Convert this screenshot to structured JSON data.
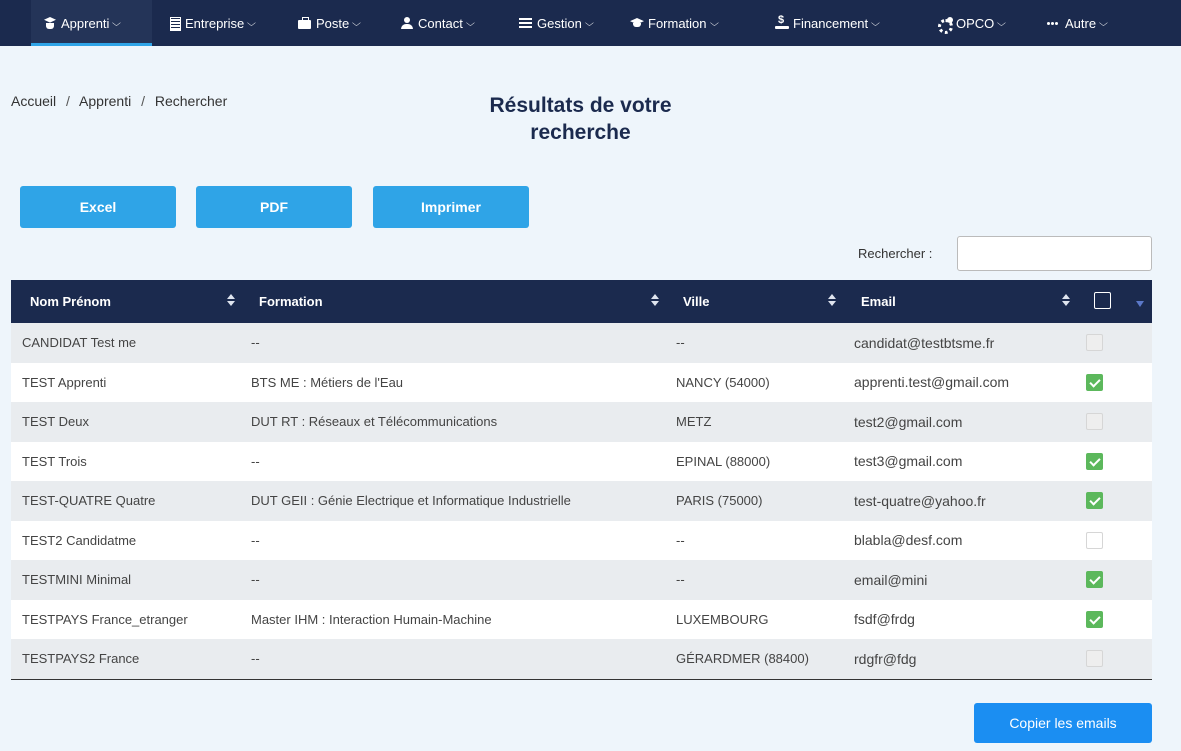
{
  "nav": [
    {
      "label": "Apprenti",
      "icon": "graduate-icon",
      "active": true
    },
    {
      "label": "Entreprise",
      "icon": "building-icon"
    },
    {
      "label": "Poste",
      "icon": "briefcase-icon"
    },
    {
      "label": "Contact",
      "icon": "user-icon"
    },
    {
      "label": "Gestion",
      "icon": "list-icon"
    },
    {
      "label": "Formation",
      "icon": "graduation-cap-icon"
    },
    {
      "label": "Financement",
      "icon": "money-hand-icon"
    },
    {
      "label": "OPCO",
      "icon": "cogs-icon"
    },
    {
      "label": "Autre",
      "icon": "ellipsis-icon"
    }
  ],
  "breadcrumb": [
    "Accueil",
    "Apprenti",
    "Rechercher"
  ],
  "breadcrumb_sep": "/",
  "title_line1": "Résultats de votre",
  "title_line2": "recherche",
  "buttons": {
    "excel": "Excel",
    "pdf": "PDF",
    "print": "Imprimer"
  },
  "search": {
    "label": "Rechercher :",
    "value": ""
  },
  "table": {
    "headers": [
      "Nom Prénom",
      "Formation",
      "Ville",
      "Email"
    ],
    "rows": [
      {
        "name": "CANDIDAT Test me",
        "formation": "--",
        "ville": "--",
        "email": "candidat@testbtsme.fr",
        "checked": false,
        "disabled": true
      },
      {
        "name": "TEST Apprenti",
        "formation": "BTS ME : Métiers de l'Eau",
        "ville": "NANCY (54000)",
        "email": "apprenti.test@gmail.com",
        "checked": true,
        "disabled": false
      },
      {
        "name": "TEST Deux",
        "formation": "DUT RT : Réseaux et Télécommunications",
        "ville": "METZ",
        "email": "test2@gmail.com",
        "checked": false,
        "disabled": true
      },
      {
        "name": "TEST Trois",
        "formation": "--",
        "ville": "EPINAL (88000)",
        "email": "test3@gmail.com",
        "checked": true,
        "disabled": false
      },
      {
        "name": "TEST-QUATRE Quatre",
        "formation": "DUT GEII : Génie Electrique et Informatique Industrielle",
        "ville": "PARIS (75000)",
        "email": "test-quatre@yahoo.fr",
        "checked": true,
        "disabled": false
      },
      {
        "name": "TEST2 Candidatme",
        "formation": "--",
        "ville": "--",
        "email": "blabla@desf.com",
        "checked": false,
        "disabled": false
      },
      {
        "name": "TESTMINI Minimal",
        "formation": "--",
        "ville": "--",
        "email": "email@mini",
        "checked": true,
        "disabled": false
      },
      {
        "name": "TESTPAYS France_etranger",
        "formation": "Master IHM : Interaction Humain-Machine",
        "ville": "LUXEMBOURG",
        "email": "fsdf@frdg",
        "checked": true,
        "disabled": false
      },
      {
        "name": "TESTPAYS2 France",
        "formation": "--",
        "ville": "GÉRARDMER (88400)",
        "email": "rdgfr@fdg",
        "checked": false,
        "disabled": true
      }
    ]
  },
  "copy_button": "Copier les emails",
  "colors": {
    "navbar": "#1b2a4e",
    "accent": "#2fa4e7",
    "check": "#5cb85c"
  }
}
